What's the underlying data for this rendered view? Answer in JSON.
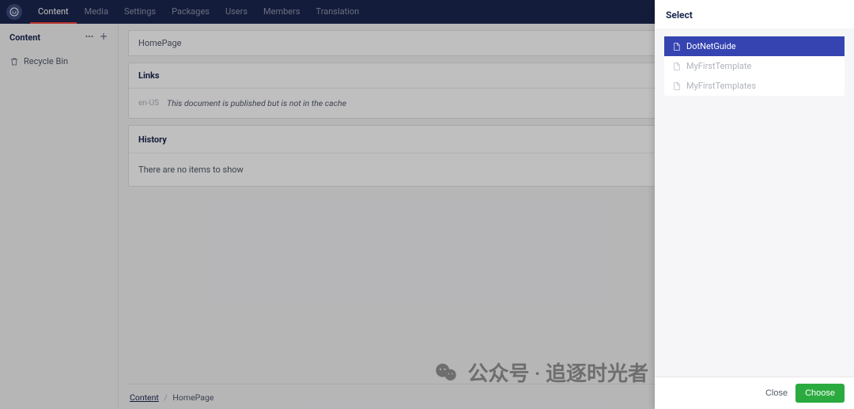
{
  "topnav": {
    "items": [
      {
        "label": "Content",
        "active": true
      },
      {
        "label": "Media",
        "active": false
      },
      {
        "label": "Settings",
        "active": false
      },
      {
        "label": "Packages",
        "active": false
      },
      {
        "label": "Users",
        "active": false
      },
      {
        "label": "Members",
        "active": false
      },
      {
        "label": "Translation",
        "active": false
      }
    ]
  },
  "sidebar": {
    "title": "Content",
    "tree": [
      {
        "label": "Recycle Bin",
        "icon": "trash"
      }
    ]
  },
  "content": {
    "title_row": "HomePage",
    "links": {
      "header": "Links",
      "lang": "en-US",
      "message": "This document is published but is not in the cache"
    },
    "history": {
      "header": "History",
      "empty_message": "There are no items to show"
    }
  },
  "breadcrumb": {
    "items": [
      {
        "label": "Content",
        "link": true
      },
      {
        "label": "HomePage",
        "link": false
      }
    ]
  },
  "panel": {
    "title": "Select",
    "items": [
      {
        "label": "DotNetGuide",
        "selected": true
      },
      {
        "label": "MyFirstTemplate",
        "selected": false
      },
      {
        "label": "MyFirstTemplates",
        "selected": false
      }
    ],
    "close_label": "Close",
    "choose_label": "Choose"
  },
  "watermark": {
    "text": "公众号 · 追逐时光者"
  }
}
